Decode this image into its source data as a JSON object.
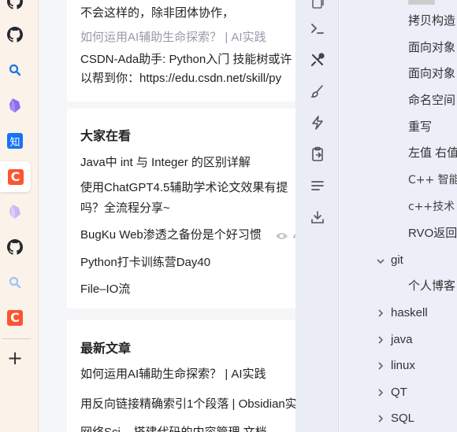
{
  "dock": {
    "items": [
      {
        "name": "github-icon"
      },
      {
        "name": "search-icon"
      },
      {
        "name": "obsidian-icon"
      },
      {
        "name": "zhihu-icon",
        "glyph": "知"
      },
      {
        "name": "csdn-icon",
        "glyph": "C",
        "active": true
      },
      {
        "name": "obsidian-icon-faded"
      },
      {
        "name": "github-icon"
      },
      {
        "name": "search-icon-faded"
      },
      {
        "name": "csdn-icon",
        "glyph": "C"
      }
    ],
    "add_glyph": "+"
  },
  "article": {
    "comment_tail": "不会这样的，除非团体协作，",
    "related_link": "如何运用AI辅助生命探索？ | AI实践",
    "ada_line1": "CSDN-Ada助手: Python入门 技能树或许",
    "ada_line2": "以帮到你：https://edu.csdn.net/skill/py"
  },
  "trending": {
    "title": "大家在看",
    "items": [
      "Java中 int 与 Integer 的区别详解",
      "使用ChatGPT4.5辅助学术论文效果有提",
      "吗？全流程分享~",
      "BugKu Web渗透之备份是个好习惯",
      "Python打卡训练营Day40",
      "File–IO流"
    ],
    "view_count": "4"
  },
  "latest": {
    "title": "最新文章",
    "items": [
      "如何运用AI辅助生命探索？ | AI实践",
      "用反向链接精确索引1个段落 | Obsidian实",
      "网络Sci... 搭建代码的内容管理 文档"
    ]
  },
  "toolbar": {
    "icons": [
      "copy-icon",
      "terminal-icon",
      "tools-icon",
      "brush-icon",
      "lightning-icon",
      "clipboard-icon",
      "list-icon",
      "download-icon"
    ]
  },
  "file_tree": {
    "notes_top": [
      "拷贝构造",
      "面向对象",
      "面向对象",
      "命名空间",
      "重写",
      "左值 右值",
      "C++ 智能",
      "c++技术",
      "RVO返回"
    ],
    "git_folder": "git",
    "git_note": "个人博客",
    "folders": [
      "haskell",
      "java",
      "linux",
      "QT",
      "SQL"
    ]
  },
  "colors": {
    "csdn": "#fc5531",
    "zhihu": "#1772f6",
    "obsidian": "#8b6cef",
    "link_gray": "#999aaa"
  }
}
